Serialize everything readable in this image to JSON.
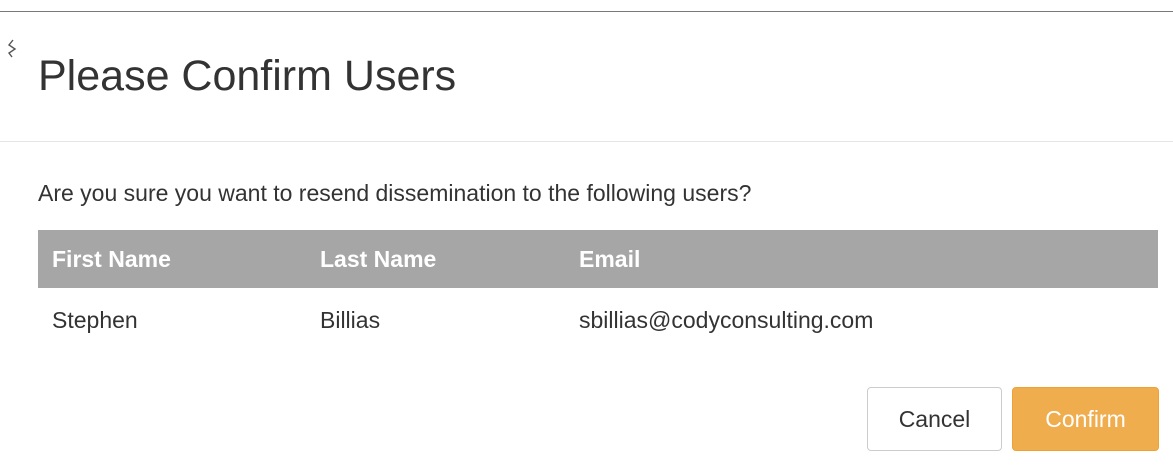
{
  "dialog": {
    "title": "Please Confirm Users",
    "message": "Are you sure you want to resend dissemination to the following users?"
  },
  "table": {
    "headers": [
      "First Name",
      "Last Name",
      "Email"
    ],
    "rows": [
      [
        "Stephen",
        "Billias",
        "sbillias@codyconsulting.com"
      ]
    ]
  },
  "buttons": {
    "cancel_label": "Cancel",
    "confirm_label": "Confirm"
  },
  "colors": {
    "header_bg": "#a6a6a6",
    "confirm_bg": "#f0ad4e",
    "text": "#333333"
  }
}
